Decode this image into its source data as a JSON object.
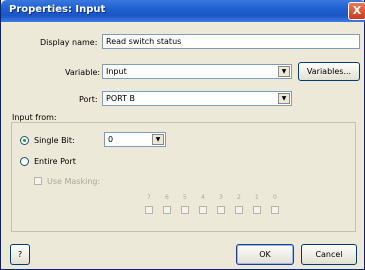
{
  "window": {
    "title": "Properties: Input",
    "close_glyph": "X"
  },
  "form": {
    "display_name_label": "Display name:",
    "display_name_value": "Read switch status",
    "variable_label": "Variable:",
    "variable_value": "Input",
    "variables_button": "Variables...",
    "port_label": "Port:",
    "port_value": "PORT B"
  },
  "input_from": {
    "group_label": "Input from:",
    "single_bit_label": "Single Bit:",
    "single_bit_value": "0",
    "single_bit_selected": true,
    "entire_port_label": "Entire Port",
    "entire_port_selected": false,
    "use_masking_label": "Use Masking:",
    "bits": [
      "7",
      "6",
      "5",
      "4",
      "3",
      "2",
      "1",
      "0"
    ]
  },
  "footer": {
    "help_label": "?",
    "ok_label": "OK",
    "cancel_label": "Cancel"
  },
  "icons": {
    "dropdown_arrow": "▼"
  }
}
